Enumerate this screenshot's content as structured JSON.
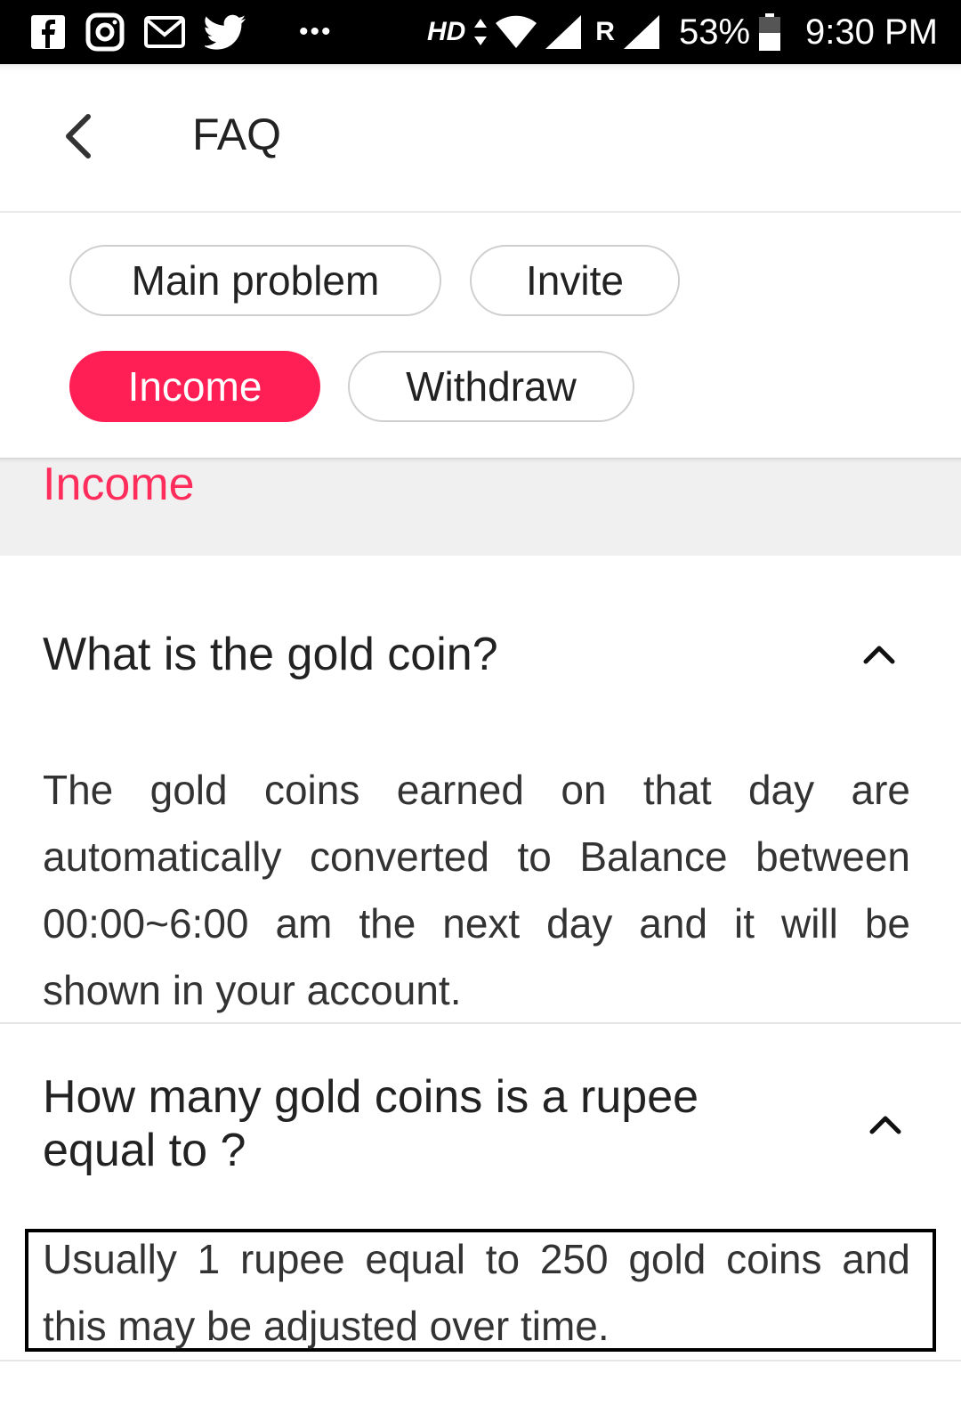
{
  "status_bar": {
    "left_icons": [
      "facebook-icon",
      "instagram-icon",
      "gmail-icon",
      "twitter-icon"
    ],
    "more": "•••",
    "hd": "HD",
    "roaming": "R",
    "battery": "53%",
    "time": "9:30 PM"
  },
  "header": {
    "title": "FAQ"
  },
  "categories": [
    {
      "label": "Main problem",
      "active": false
    },
    {
      "label": "Invite",
      "active": false
    },
    {
      "label": "Income",
      "active": true
    },
    {
      "label": "Withdraw",
      "active": false
    }
  ],
  "section": {
    "title": "Income"
  },
  "faqs": [
    {
      "question": "What is the gold coin?",
      "answer": "The gold coins earned on that day are automatically converted to Balance between 00:00~6:00 am the next day and it will be shown in your account.",
      "expanded": true
    },
    {
      "question": "How many gold coins is a rupee equal to ?",
      "answer": "Usually 1 rupee equal to 250 gold coins and this may be adjusted over time.",
      "expanded": true
    }
  ],
  "colors": {
    "accent": "#ff1f55",
    "section_title": "#ff2d5c",
    "status_bar": "#000000"
  }
}
